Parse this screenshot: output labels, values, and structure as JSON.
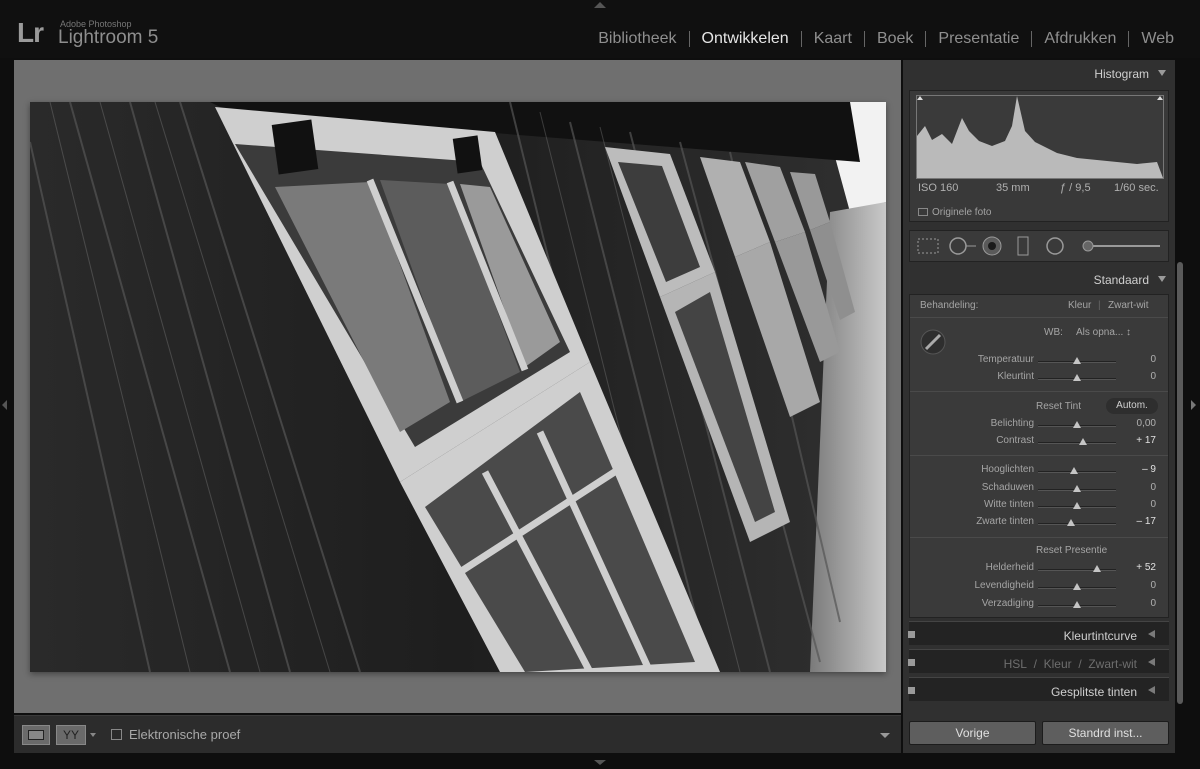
{
  "app": {
    "vendor": "Adobe Photoshop",
    "name": "Lightroom 5",
    "logo": "Lr"
  },
  "modules": [
    "Bibliotheek",
    "Ontwikkelen",
    "Kaart",
    "Boek",
    "Presentatie",
    "Afdrukken",
    "Web"
  ],
  "active_module": "Ontwikkelen",
  "toolbar": {
    "view_compare": "YY",
    "soft_proof_label": "Elektronische proef"
  },
  "histogram": {
    "title": "Histogram",
    "iso": "ISO 160",
    "focal": "35 mm",
    "aperture": "ƒ / 9,5",
    "shutter": "1/60 sec.",
    "original_label": "Originele foto"
  },
  "basic": {
    "title": "Standaard",
    "treatment_label": "Behandeling:",
    "treatment_color": "Kleur",
    "treatment_bw": "Zwart-wit",
    "wb_label": "WB:",
    "wb_value": "Als opna... ↕",
    "reset_tone": "Reset Tint",
    "auto": "Autom.",
    "reset_presence": "Reset Presentie",
    "sliders": [
      {
        "label": "Temperatuur",
        "value": "0",
        "pos": 0.5
      },
      {
        "label": "Kleurtint",
        "value": "0",
        "pos": 0.5
      },
      {
        "label": "Belichting",
        "value": "0,00",
        "pos": 0.5
      },
      {
        "label": "Contrast",
        "value": "+ 17",
        "pos": 0.58
      },
      {
        "label": "Hooglichten",
        "value": "– 9",
        "pos": 0.46
      },
      {
        "label": "Schaduwen",
        "value": "0",
        "pos": 0.5
      },
      {
        "label": "Witte tinten",
        "value": "0",
        "pos": 0.5
      },
      {
        "label": "Zwarte tinten",
        "value": "– 17",
        "pos": 0.42
      },
      {
        "label": "Helderheid",
        "value": "+ 52",
        "pos": 0.76
      },
      {
        "label": "Levendigheid",
        "value": "0",
        "pos": 0.5
      },
      {
        "label": "Verzadiging",
        "value": "0",
        "pos": 0.5
      }
    ]
  },
  "panels": {
    "tone_curve": "Kleurtintcurve",
    "hsl": "HSL",
    "hsl_color": "Kleur",
    "hsl_bw": "Zwart-wit",
    "split_toning": "Gesplitste tinten",
    "slash": "/"
  },
  "buttons": {
    "previous": "Vorige",
    "defaults": "Standrd inst..."
  }
}
